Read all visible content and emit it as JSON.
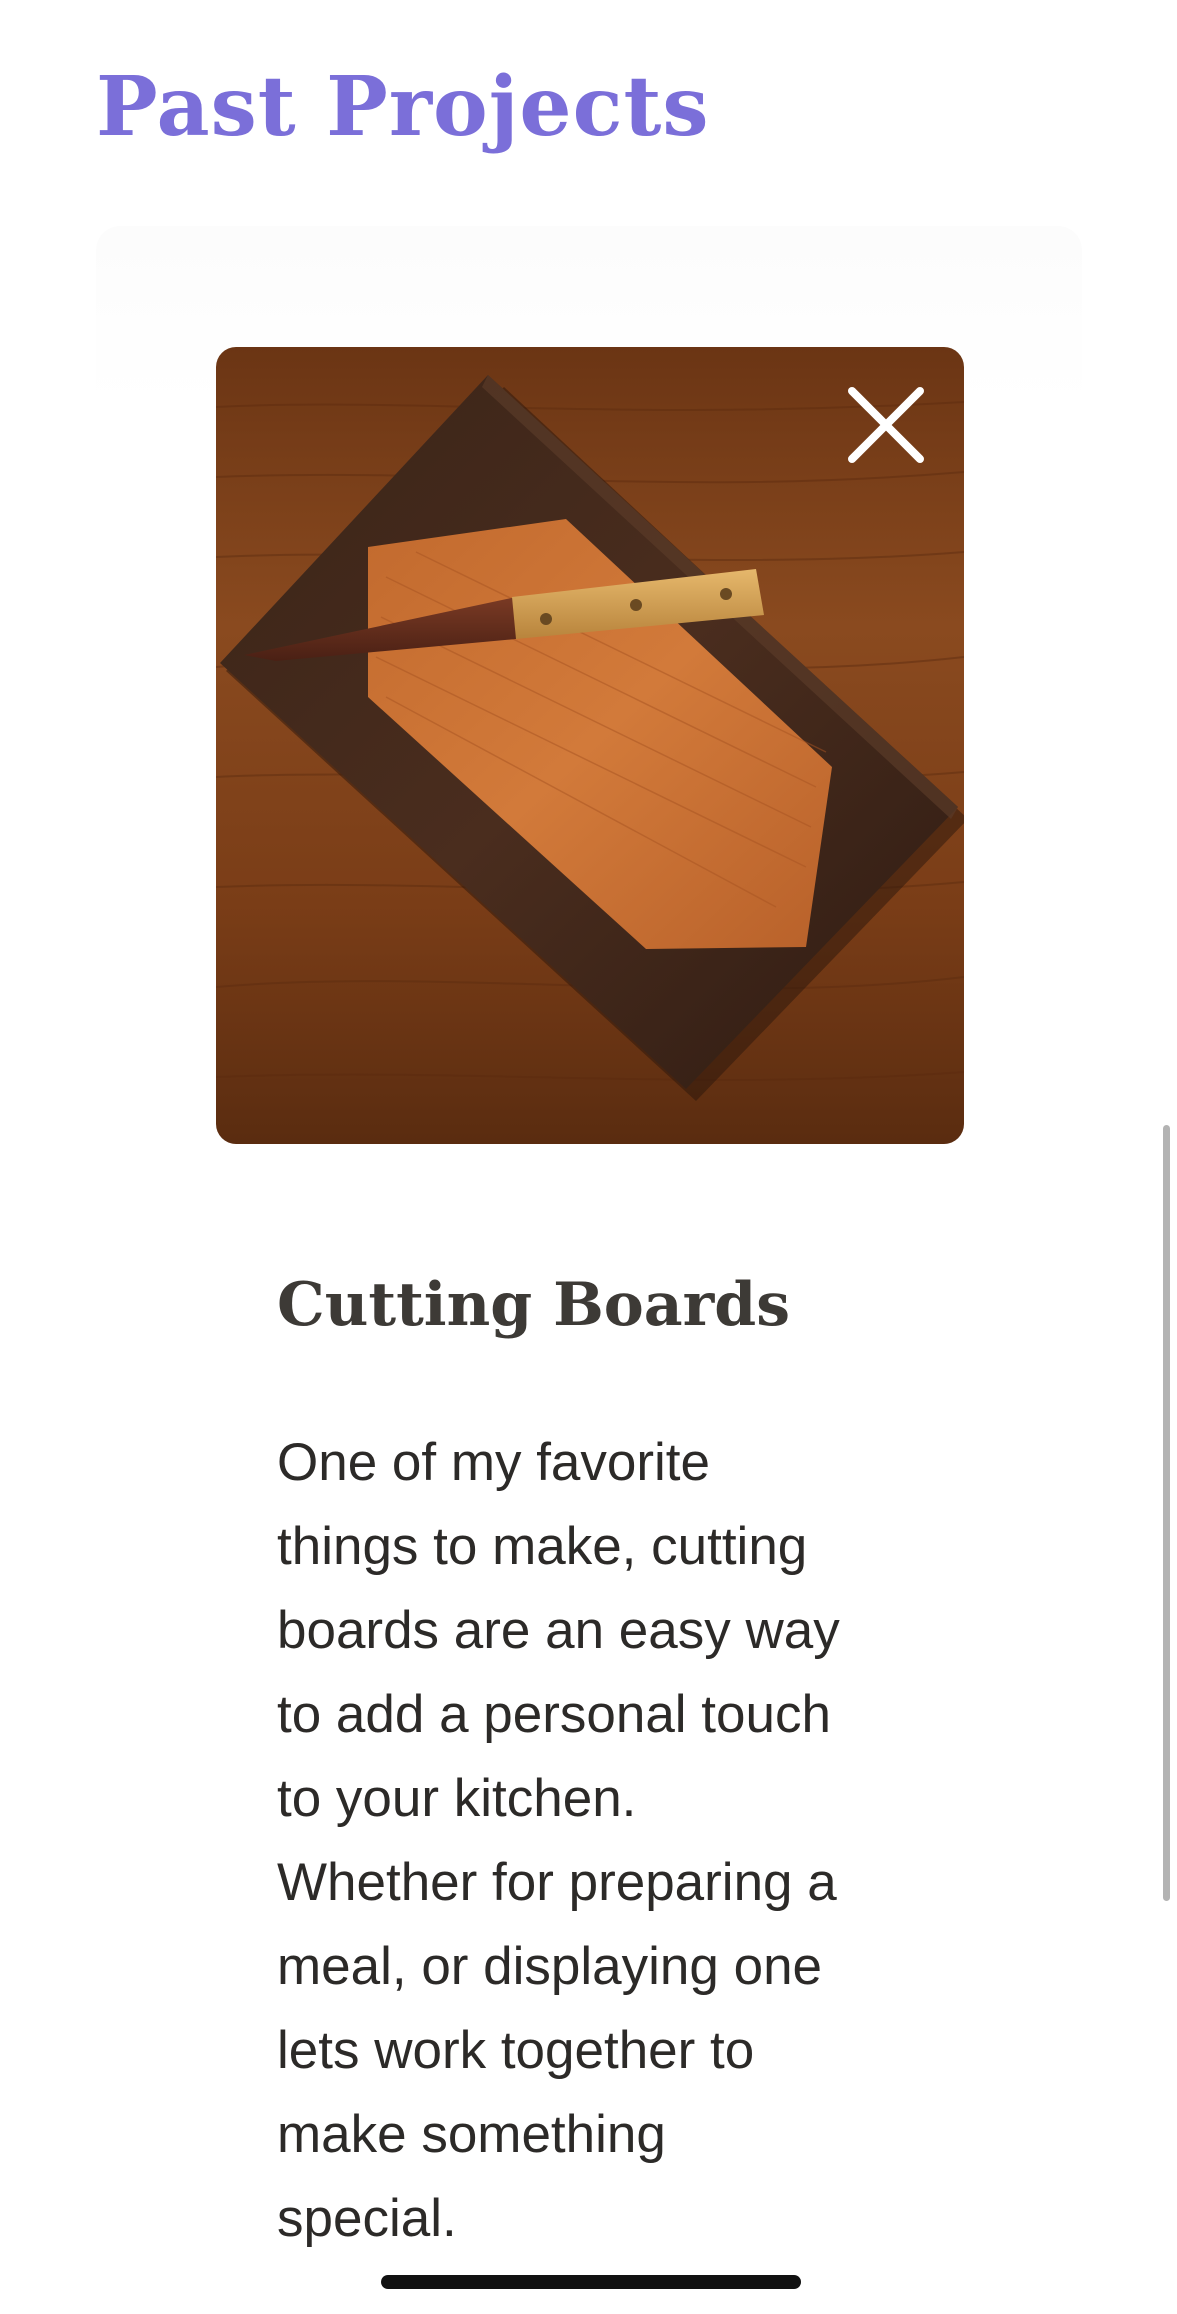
{
  "page": {
    "heading": "Past Projects"
  },
  "modal": {
    "close_icon": "close-icon",
    "image_icon": "cutting-board-photo",
    "title": "Cutting Boards",
    "description_lines": [
      "One of my favorite",
      "things to make, cutting",
      "boards are an easy way",
      "to add a personal touch",
      "to your kitchen.",
      "Whether for preparing a",
      "meal, or displaying one",
      "lets work together to",
      "make something",
      "special."
    ]
  },
  "colors": {
    "heading": "#7b6fd9",
    "title": "#3d3a36",
    "body_text": "#2c2a28",
    "close_icon": "#ffffff"
  }
}
